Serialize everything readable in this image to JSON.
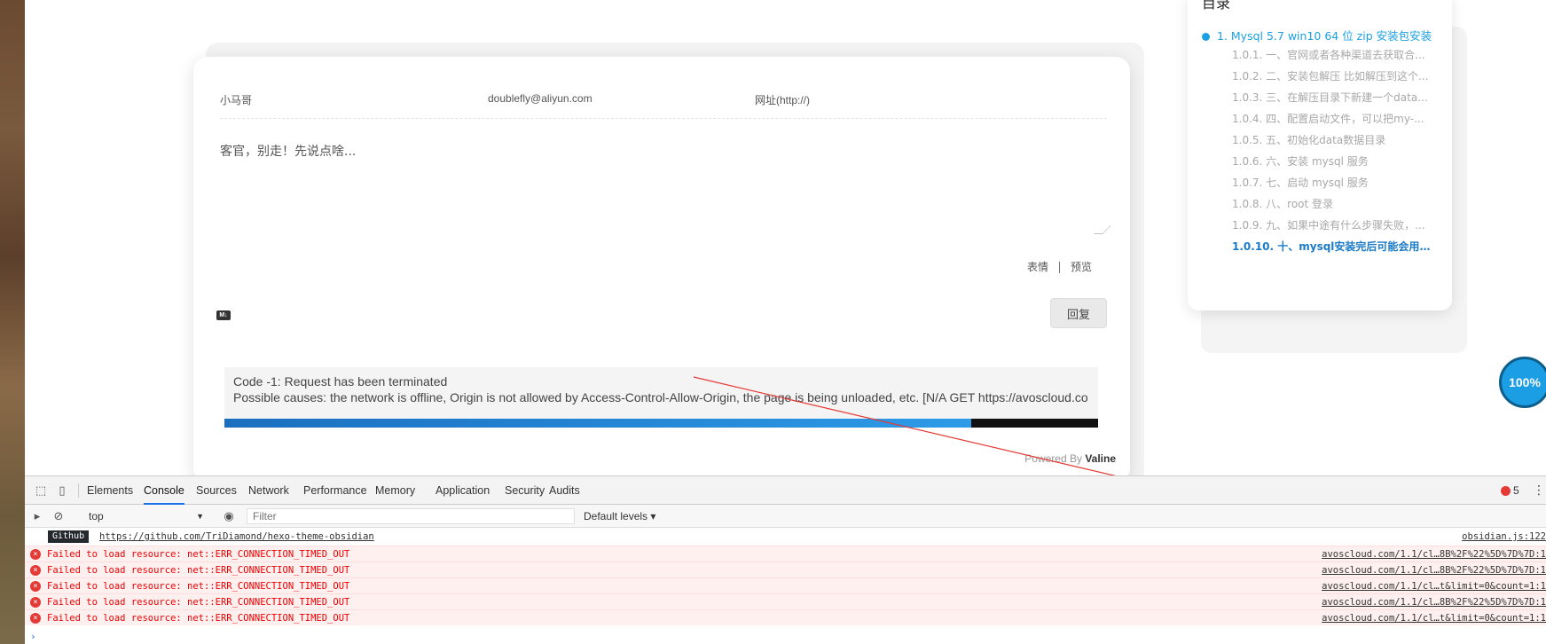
{
  "comment_form": {
    "nick_placeholder": "小马哥",
    "email_value": "doublefly@aliyun.com",
    "link_placeholder": "网址(http://)",
    "editor_placeholder": "客官，别走！先说点啥...",
    "emoji_label": "表情",
    "preview_label": "预览",
    "md_icon_label": "M↓",
    "reply_label": "回复",
    "error_line1": "Code -1: Request has been terminated",
    "error_line2": "Possible causes: the network is offline, Origin is not allowed by Access-Control-Allow-Origin, the page is being unloaded, etc. [N/A GET https://avoscloud.co",
    "progress_fraction": 0.855,
    "powered_prefix": "Powered By ",
    "powered_brand": "Valine"
  },
  "toc": {
    "title": "目录",
    "main_item": "1.  Mysql 5.7 win10 64 位 zip 安装包安装",
    "items": [
      "1.0.1.  一、官网或者各种渠道去获取合...",
      "1.0.2.  二、安装包解压 比如解压到这个...",
      "1.0.3.  三、在解压目录下新建一个data...",
      "1.0.4.  四、配置启动文件，可以把my-...",
      "1.0.5.  五、初始化data数据目录",
      "1.0.6.  六、安装 mysql 服务",
      "1.0.7.  七、启动 mysql 服务",
      "1.0.8.  八、root 登录",
      "1.0.9.  九、如果中途有什么步骤失败，...",
      "1.0.10.  十、mysql安装完后可能会用到..."
    ],
    "active_index": 9
  },
  "zoom_badge": "100%",
  "devtools": {
    "tabs": [
      "Elements",
      "Console",
      "Sources",
      "Network",
      "Performance",
      "Memory",
      "Application",
      "Security",
      "Audits"
    ],
    "active_tab": "Console",
    "error_count": "5",
    "context": "top",
    "filter_placeholder": "Filter",
    "levels": "Default levels ▾",
    "logs": {
      "info_badge": "Github",
      "info_link": "https://github.com/TriDiamond/hexo-theme-obsidian",
      "info_source": "obsidian.js:122",
      "errors": [
        {
          "msg": "Failed to load resource: net::ERR_CONNECTION_TIMED_OUT",
          "src": "avoscloud.com/1.1/cl…8B%2F%22%5D%7D%7D:1"
        },
        {
          "msg": "Failed to load resource: net::ERR_CONNECTION_TIMED_OUT",
          "src": "avoscloud.com/1.1/cl…8B%2F%22%5D%7D%7D:1"
        },
        {
          "msg": "Failed to load resource: net::ERR_CONNECTION_TIMED_OUT",
          "src": "avoscloud.com/1.1/cl…t&limit=0&count=1:1"
        },
        {
          "msg": "Failed to load resource: net::ERR_CONNECTION_TIMED_OUT",
          "src": "avoscloud.com/1.1/cl…8B%2F%22%5D%7D%7D:1"
        },
        {
          "msg": "Failed to load resource: net::ERR_CONNECTION_TIMED_OUT",
          "src": "avoscloud.com/1.1/cl…t&limit=0&count=1:1"
        }
      ]
    }
  },
  "colors": {
    "accent": "#1ba0e1",
    "annotation": "#e53935",
    "error_text": "#e00000"
  }
}
